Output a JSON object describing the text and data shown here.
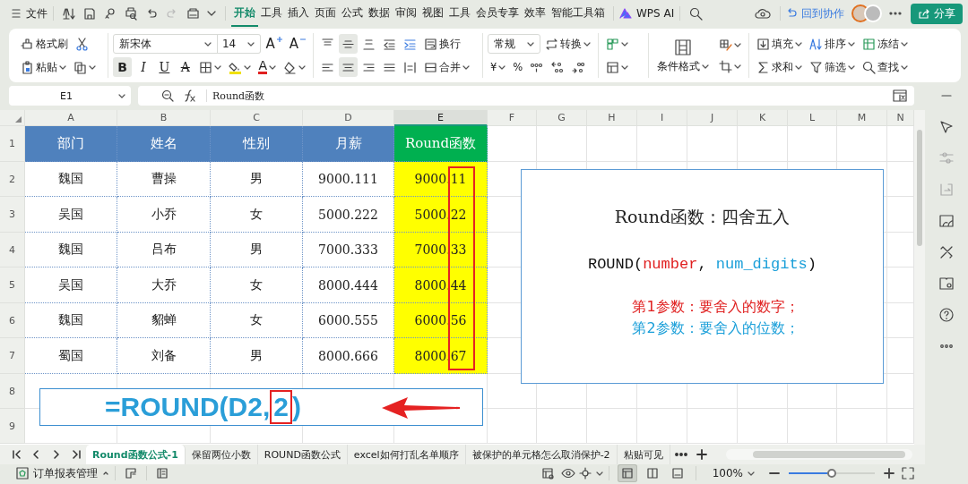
{
  "top_bar": {
    "file_menu": "文件",
    "tabs": [
      {
        "label": "开始",
        "selected": true
      },
      {
        "label": "工具",
        "selected": false
      },
      {
        "label": "插入",
        "selected": false
      },
      {
        "label": "页面",
        "selected": false
      },
      {
        "label": "公式",
        "selected": false
      },
      {
        "label": "数据",
        "selected": false
      },
      {
        "label": "审阅",
        "selected": false
      },
      {
        "label": "视图",
        "selected": false
      },
      {
        "label": "工具",
        "selected": false
      },
      {
        "label": "会员专享",
        "selected": false
      },
      {
        "label": "效率",
        "selected": false
      },
      {
        "label": "智能工具箱",
        "selected": false
      }
    ],
    "ai_label": "WPS AI",
    "collab_button": "回到协作",
    "share_button": "分享"
  },
  "ribbon": {
    "format_painter": "格式刷",
    "paste": "粘贴",
    "font_name": "新宋体",
    "font_size": "14",
    "grow_font": "A",
    "shrink_font": "A",
    "bold": {
      "label": "B",
      "on": true
    },
    "italic": {
      "label": "I",
      "on": false
    },
    "underline": {
      "label": "U",
      "on": false
    },
    "strikethrough": {
      "label": "A",
      "on": false
    },
    "font_color": "A",
    "vertical_align": [
      {
        "selected": false
      },
      {
        "selected": true
      },
      {
        "selected": false
      }
    ],
    "horizontal_align": [
      {
        "selected": false
      },
      {
        "selected": true
      },
      {
        "selected": false
      },
      {
        "selected": false
      }
    ],
    "wrap": "换行",
    "merge": "合并",
    "number_format": "常规",
    "convert": "转换",
    "currency": "¥",
    "percent": "%",
    "conditional_format": "条件格式",
    "fill": "填充",
    "sort": "排序",
    "freeze": "冻结",
    "sum": "求和",
    "filter": "筛选",
    "find": "查找"
  },
  "formula_bar": {
    "cell_ref": "E1",
    "formula": "Round函数"
  },
  "sheet": {
    "columns": [
      {
        "label": "A",
        "selected": false
      },
      {
        "label": "B",
        "selected": false
      },
      {
        "label": "C",
        "selected": false
      },
      {
        "label": "D",
        "selected": false
      },
      {
        "label": "E",
        "selected": true
      },
      {
        "label": "F",
        "selected": false
      },
      {
        "label": "G",
        "selected": false
      },
      {
        "label": "H",
        "selected": false
      },
      {
        "label": "I",
        "selected": false
      },
      {
        "label": "J",
        "selected": false
      },
      {
        "label": "K",
        "selected": false
      },
      {
        "label": "L",
        "selected": false
      },
      {
        "label": "M",
        "selected": false
      },
      {
        "label": "N",
        "selected": false
      }
    ],
    "rows": [
      "1",
      "2",
      "3",
      "4",
      "5",
      "6",
      "7",
      "8",
      "9"
    ],
    "table": {
      "header": [
        {
          "text": "部门",
          "color": "#4f81bd",
          "highlighted": false
        },
        {
          "text": "姓名",
          "color": "#4f81bd",
          "highlighted": false
        },
        {
          "text": "性别",
          "color": "#4f81bd",
          "highlighted": false
        },
        {
          "text": "月薪",
          "color": "#4f81bd",
          "highlighted": false
        },
        {
          "text": "Round函数",
          "color": "#00b050",
          "highlighted": true
        }
      ],
      "rows": [
        [
          "魏国",
          "曹操",
          "男",
          "9000.111",
          "9000.11"
        ],
        [
          "吴国",
          "小乔",
          "女",
          "5000.222",
          "5000.22"
        ],
        [
          "魏国",
          "吕布",
          "男",
          "7000.333",
          "7000.33"
        ],
        [
          "吴国",
          "大乔",
          "女",
          "8000.444",
          "8000.44"
        ],
        [
          "魏国",
          "貂蝉",
          "女",
          "6000.555",
          "6000.56"
        ],
        [
          "蜀国",
          "刘备",
          "男",
          "8000.666",
          "8000.67"
        ]
      ]
    }
  },
  "text_box": {
    "title": "Round函数：四舍五入",
    "syntax": [
      {
        "text": "ROUND(",
        "color": "#111111"
      },
      {
        "text": "number",
        "color": "#e02020"
      },
      {
        "text": ", ",
        "color": "#111111"
      },
      {
        "text": "num_digits",
        "color": "#1a9fd9"
      },
      {
        "text": ")",
        "color": "#111111"
      }
    ],
    "notes": [
      {
        "text": "第1参数：要舍入的数字；",
        "color": "#e02020"
      },
      {
        "text": "第2参数：要舍入的位数；",
        "color": "#1a9fd9"
      }
    ]
  },
  "formula_callout": {
    "parts": [
      {
        "text": "=ROUND(D2,",
        "boxed": false
      },
      {
        "text": "2",
        "boxed": true
      },
      {
        "text": ")",
        "boxed": false
      }
    ]
  },
  "sheet_tabs": [
    {
      "label": "Round函数公式-1",
      "selected": true
    },
    {
      "label": "保留两位小数",
      "selected": false
    },
    {
      "label": "ROUND函数公式",
      "selected": false
    },
    {
      "label": "excel如何打乱名单顺序",
      "selected": false
    },
    {
      "label": "被保护的单元格怎么取消保护-2",
      "selected": false
    },
    {
      "label": "粘贴可见",
      "selected": false
    }
  ],
  "status_bar": {
    "workbook": "订单报表管理",
    "view_modes": [
      {
        "selected": true
      },
      {
        "selected": false
      },
      {
        "selected": false
      }
    ],
    "zoom": "100%",
    "zoom_slider": {
      "level": 0.5
    }
  }
}
